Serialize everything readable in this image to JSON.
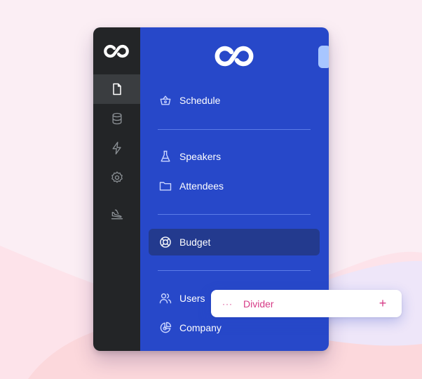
{
  "rail": {
    "items": [
      {
        "icon": "file-icon",
        "active": true
      },
      {
        "icon": "database-icon",
        "active": false
      },
      {
        "icon": "lightning-icon",
        "active": false
      },
      {
        "icon": "gear-icon",
        "active": false
      },
      {
        "icon": "plane-landing-icon",
        "active": false
      }
    ]
  },
  "panel": {
    "items": [
      {
        "label": "Schedule",
        "icon": "basket-icon"
      },
      {
        "label": "Speakers",
        "icon": "flask-icon"
      },
      {
        "label": "Attendees",
        "icon": "folder-icon"
      },
      {
        "label": "Budget",
        "icon": "lifebuoy-icon",
        "active": true
      },
      {
        "label": "Users",
        "icon": "users-icon"
      },
      {
        "label": "Company",
        "icon": "pie-chart-icon"
      }
    ]
  },
  "drag_item": {
    "handle": "···",
    "label": "Divider",
    "add": "+"
  },
  "colors": {
    "rail_bg": "#232527",
    "panel_bg": "#2748c9",
    "active_item_bg": "#233a8e",
    "accent_pink": "#d63a86"
  }
}
